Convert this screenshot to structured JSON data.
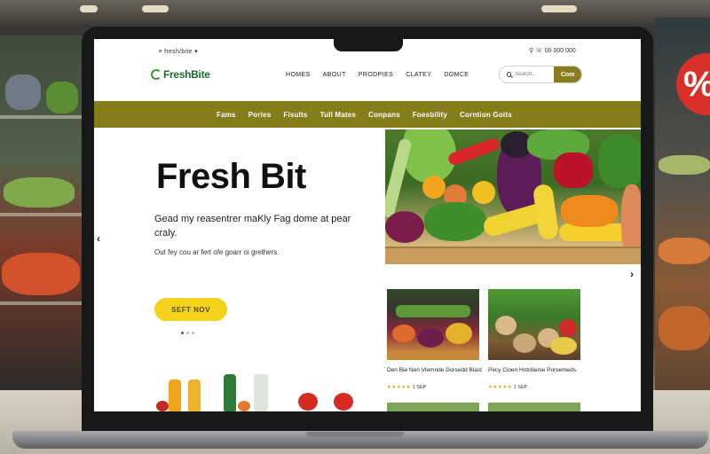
{
  "site": {
    "logo_text": "FreshBite",
    "utility_left": "ᅠ≡ fresh/bite ▾",
    "utility_right": "⚲ ☏ 00 000 000"
  },
  "top_nav": [
    "HOMES",
    "ABOUT",
    "PRODPIES",
    "CLATEY",
    "DOMCE"
  ],
  "search": {
    "placeholder": "Search...",
    "button_label": "Com"
  },
  "categories": [
    "Fams",
    "Pories",
    "Fisults",
    "Tull Mates",
    "Conpans",
    "Foesbility",
    "Corntion Goits"
  ],
  "hero": {
    "title": "Fresh Bit",
    "subtitle": "Gead my reasentrer maKly Fag dome at pear craly.",
    "small_text": "Out fey cou ar fert ofe goarr oi grethers.",
    "cta_label": "SEFT NOV"
  },
  "cards": [
    {
      "title": "Den Bie Nen Vlemnde Dorsedd Blast",
      "stars": "★★★★★",
      "meta": "1 SEP"
    },
    {
      "title": "Pecy Cioen Hntotienie Porsemeds.",
      "stars": "★★★★★",
      "meta": "1 SEP"
    }
  ],
  "colors": {
    "brand_green": "#1e6b2a",
    "category_bar": "#857c1a",
    "cta_yellow": "#f2d21b",
    "search_button": "#8b7d1e"
  }
}
